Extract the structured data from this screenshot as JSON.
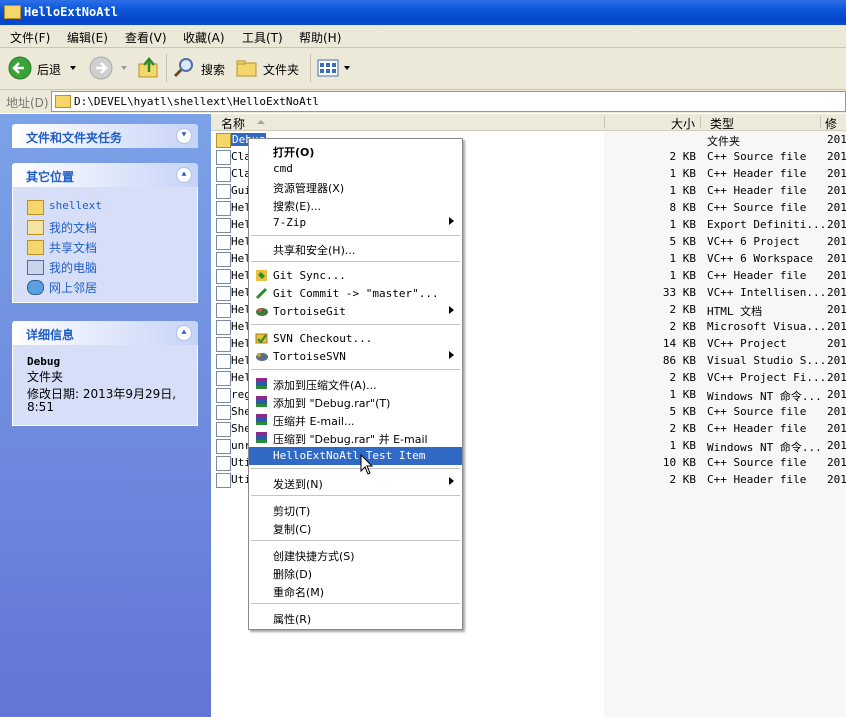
{
  "window": {
    "title": "HelloExtNoAtl"
  },
  "menubar": {
    "items": [
      "文件(F)",
      "编辑(E)",
      "查看(V)",
      "收藏(A)",
      "工具(T)",
      "帮助(H)"
    ]
  },
  "toolbar": {
    "back_label": "后退",
    "search_label": "搜索",
    "folders_label": "文件夹"
  },
  "address": {
    "label": "地址(D)",
    "path": "D:\\DEVEL\\hyatl\\shellext\\HelloExtNoAtl"
  },
  "tasks": {
    "file_tasks_title": "文件和文件夹任务",
    "other_places_title": "其它位置",
    "other_places": [
      "shellext",
      "我的文档",
      "共享文档",
      "我的电脑",
      "网上邻居"
    ],
    "details_title": "详细信息",
    "details_name": "Debug",
    "details_type": "文件夹",
    "details_modified_label": "修改日期: 2013年9月29日,",
    "details_modified_time": "8:51"
  },
  "columns": {
    "name": "名称",
    "size": "大小",
    "type": "类型",
    "modified": "修改"
  },
  "rows": [
    {
      "name": "Debug",
      "size": "",
      "type": "文件夹",
      "date": "201"
    },
    {
      "name": "Cla",
      "size": "2 KB",
      "type": "C++ Source file",
      "date": "201"
    },
    {
      "name": "Cla",
      "size": "1 KB",
      "type": "C++ Header file",
      "date": "201"
    },
    {
      "name": "Gui",
      "size": "1 KB",
      "type": "C++ Header file",
      "date": "201"
    },
    {
      "name": "Hel",
      "size": "8 KB",
      "type": "C++ Source file",
      "date": "201"
    },
    {
      "name": "Hel",
      "size": "1 KB",
      "type": "Export Definiti...",
      "date": "201"
    },
    {
      "name": "Hel",
      "size": "5 KB",
      "type": "VC++ 6 Project",
      "date": "201"
    },
    {
      "name": "Hel",
      "size": "1 KB",
      "type": "VC++ 6 Workspace",
      "date": "201"
    },
    {
      "name": "Hel",
      "size": "1 KB",
      "type": "C++ Header file",
      "date": "201"
    },
    {
      "name": "Hel",
      "size": "33 KB",
      "type": "VC++ Intellisen...",
      "date": "201"
    },
    {
      "name": "Hel",
      "size": "2 KB",
      "type": "HTML 文档",
      "date": "201"
    },
    {
      "name": "Hel",
      "size": "2 KB",
      "type": "Microsoft Visua...",
      "date": "201"
    },
    {
      "name": "Hel",
      "size": "14 KB",
      "type": "VC++ Project",
      "date": "201"
    },
    {
      "name": "Hel",
      "size": "86 KB",
      "type": "Visual Studio S...",
      "date": "201"
    },
    {
      "name": "Hel",
      "size": "2 KB",
      "type": "VC++ Project Fi...",
      "date": "201"
    },
    {
      "name": "reg",
      "size": "1 KB",
      "type": "Windows NT 命令...",
      "date": "201"
    },
    {
      "name": "She",
      "size": "5 KB",
      "type": "C++ Source file",
      "date": "201"
    },
    {
      "name": "She",
      "size": "2 KB",
      "type": "C++ Header file",
      "date": "201"
    },
    {
      "name": "unr",
      "size": "1 KB",
      "type": "Windows NT 命令...",
      "date": "201"
    },
    {
      "name": "Uti",
      "size": "10 KB",
      "type": "C++ Source file",
      "date": "201"
    },
    {
      "name": "Uti",
      "size": "2 KB",
      "type": "C++ Header file",
      "date": "201"
    }
  ],
  "context_menu": {
    "open": "打开(O)",
    "cmd": "cmd",
    "explorer": "资源管理器(X)",
    "search": "搜索(E)...",
    "zip7": "7-Zip",
    "share": "共享和安全(H)...",
    "git_sync": "Git Sync...",
    "git_commit": "Git Commit -> \"master\"...",
    "tortoise_git": "TortoiseGit",
    "svn_checkout": "SVN Checkout...",
    "tortoise_svn": "TortoiseSVN",
    "add_archive": "添加到压缩文件(A)...",
    "add_rar": "添加到 \"Debug.rar\"(T)",
    "compress_email": "压缩并 E-mail...",
    "compress_rar_email": "压缩到 \"Debug.rar\" 并 E-mail",
    "hello_item": "HelloExtNoAtl Test Item",
    "send_to": "发送到(N)",
    "cut": "剪切(T)",
    "copy": "复制(C)",
    "create_shortcut": "创建快捷方式(S)",
    "delete": "删除(D)",
    "rename": "重命名(M)",
    "properties": "属性(R)"
  },
  "colors": {
    "title_blue": "#0a56d8",
    "task_pane_blue": "#6f8fe0",
    "highlight": "#316ac5"
  }
}
